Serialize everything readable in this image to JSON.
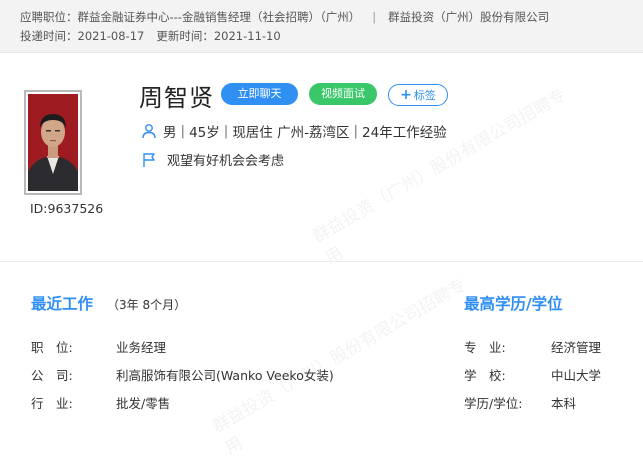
{
  "header": {
    "applied_label": "应聘职位：",
    "applied_position": "群益金融证券中心---金融销售经理（社会招聘）（广州）",
    "company": "群益投资（广州）股份有限公司",
    "submit_label": "投递时间：",
    "submit_date": "2021-08-17",
    "update_label": "更新时间：",
    "update_date": "2021-11-10"
  },
  "profile": {
    "id_text": "ID:9637526",
    "name": "周智贤",
    "btn_chat": "立即聊天",
    "btn_video": "视频面试",
    "btn_tag_plus": "+",
    "btn_tag": "标签",
    "gender": "男",
    "age": "45岁",
    "residence": "现居住 广州-荔湾区",
    "experience": "24年工作经验",
    "job_status": "观望有好机会会考虑"
  },
  "recent_work": {
    "title": "最近工作",
    "duration": "（3年 8个月）",
    "rows": [
      {
        "label": "职　位:",
        "value": "业务经理"
      },
      {
        "label": "公　司:",
        "value": "利高服饰有限公司(Wanko Veeko女装)"
      },
      {
        "label": "行　业:",
        "value": "批发/零售"
      }
    ]
  },
  "education": {
    "title": "最高学历/学位",
    "rows": [
      {
        "label": "专　业:",
        "value": "经济管理"
      },
      {
        "label": "学　校:",
        "value": "中山大学"
      },
      {
        "label": "学历/学位:",
        "value": "本科"
      }
    ]
  },
  "watermark": {
    "line1": "群益投资（广州）股份有限公司招聘专",
    "line2": "用"
  },
  "colors": {
    "accent": "#2f8ff3",
    "video": "#39c76a",
    "photo_bg": "#9e1b22"
  },
  "icons": {
    "gender": "person-icon",
    "status": "flag-icon"
  }
}
